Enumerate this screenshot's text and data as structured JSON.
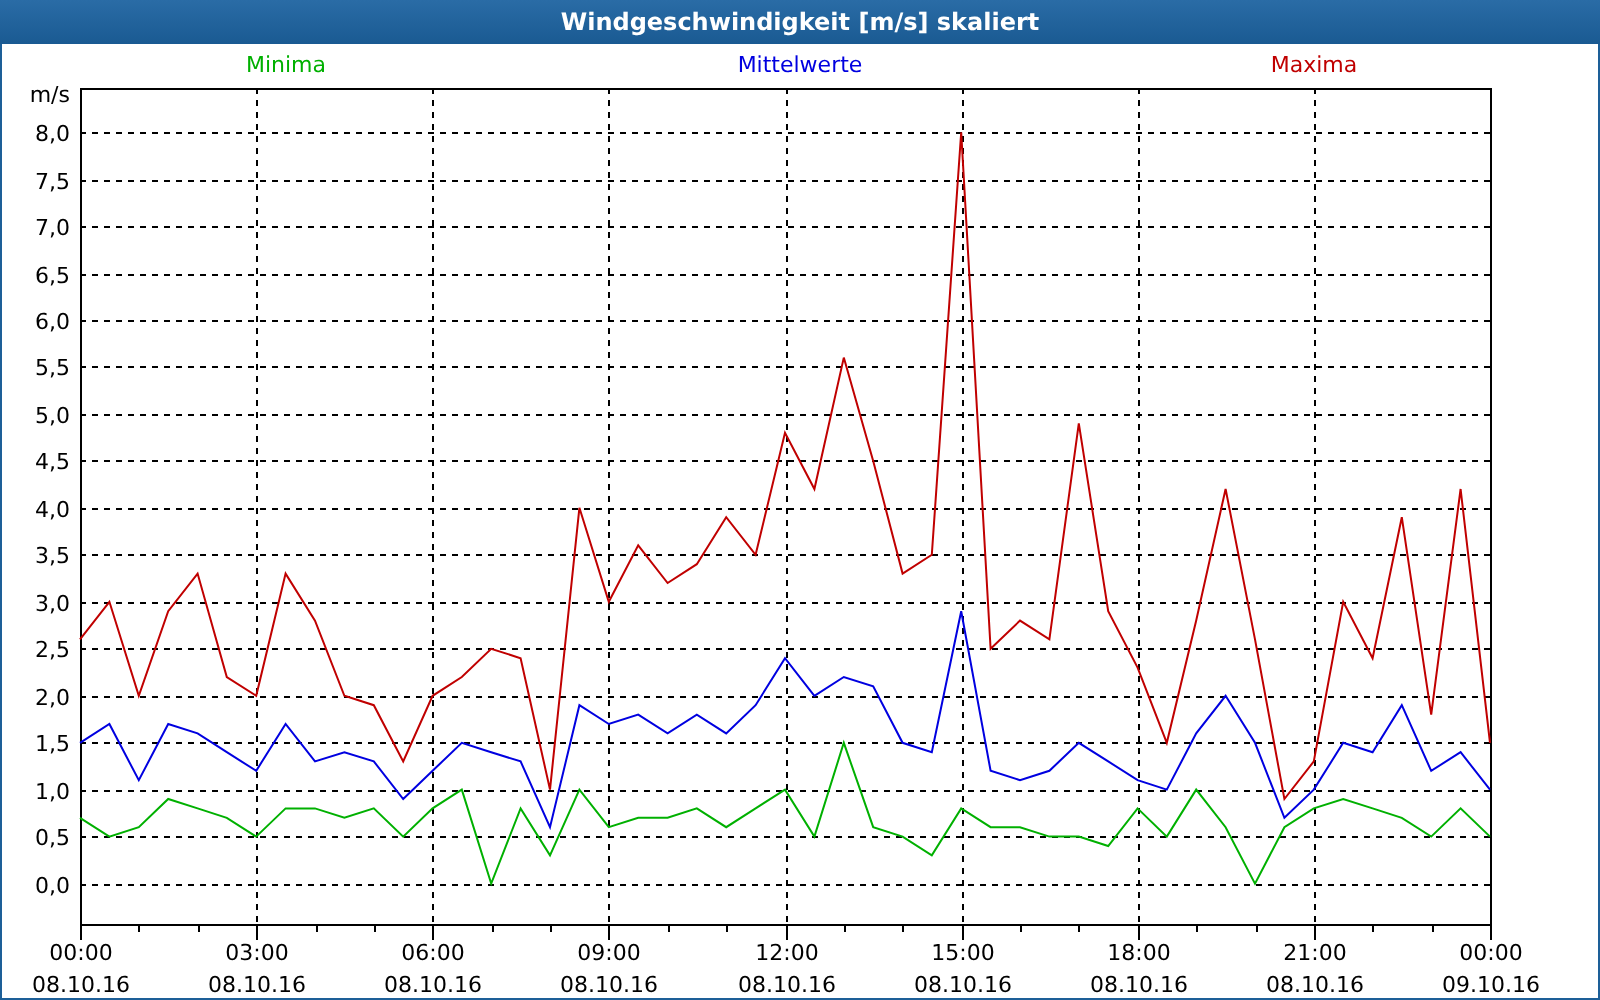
{
  "window": {
    "title": "Windgeschwindigkeit [m/s] skaliert"
  },
  "chart": {
    "chart_data": {
      "type": "line",
      "ylabel": "m/s",
      "x": [
        0,
        0.5,
        1,
        1.5,
        2,
        2.5,
        3,
        3.5,
        4,
        4.5,
        5,
        5.5,
        6,
        6.5,
        7,
        7.5,
        8,
        8.5,
        9,
        9.5,
        10,
        10.5,
        11,
        11.5,
        12,
        12.5,
        13,
        13.5,
        14,
        14.5,
        15,
        15.5,
        16,
        16.5,
        17,
        17.5,
        18,
        18.5,
        19,
        19.5,
        20,
        20.5,
        21,
        21.5,
        22,
        22.5,
        23,
        23.5,
        24
      ],
      "series": [
        {
          "name": "Minima",
          "color": "#00b000",
          "values": [
            0.7,
            0.5,
            0.6,
            0.9,
            0.8,
            0.7,
            0.5,
            0.8,
            0.8,
            0.7,
            0.8,
            0.5,
            0.8,
            1.0,
            0.0,
            0.8,
            0.3,
            1.0,
            0.6,
            0.7,
            0.7,
            0.8,
            0.6,
            0.8,
            1.0,
            0.5,
            1.5,
            0.6,
            0.5,
            0.3,
            0.8,
            0.6,
            0.6,
            0.5,
            0.5,
            0.4,
            0.8,
            0.5,
            1.0,
            0.6,
            0.0,
            0.6,
            0.8,
            0.9,
            0.8,
            0.7,
            0.5,
            0.8,
            0.5
          ]
        },
        {
          "name": "Mittelwerte",
          "color": "#0000e0",
          "values": [
            1.5,
            1.7,
            1.1,
            1.7,
            1.6,
            1.4,
            1.2,
            1.7,
            1.3,
            1.4,
            1.3,
            0.9,
            1.2,
            1.5,
            1.4,
            1.3,
            0.6,
            1.9,
            1.7,
            1.8,
            1.6,
            1.8,
            1.6,
            1.9,
            2.4,
            2.0,
            2.2,
            2.1,
            1.5,
            1.4,
            2.9,
            1.2,
            1.1,
            1.2,
            1.5,
            1.3,
            1.1,
            1.0,
            1.6,
            2.0,
            1.5,
            0.7,
            1.0,
            1.5,
            1.4,
            1.9,
            1.2,
            1.4,
            1.0
          ]
        },
        {
          "name": "Maxima",
          "color": "#c00000",
          "values": [
            2.6,
            3.0,
            2.0,
            2.9,
            3.3,
            2.2,
            2.0,
            3.3,
            2.8,
            2.0,
            1.9,
            1.3,
            2.0,
            2.2,
            2.5,
            2.4,
            1.0,
            4.0,
            3.0,
            3.6,
            3.2,
            3.4,
            3.9,
            3.5,
            4.8,
            4.2,
            5.6,
            4.5,
            3.3,
            3.5,
            8.0,
            2.5,
            2.8,
            2.6,
            4.9,
            2.9,
            2.3,
            1.5,
            2.8,
            4.2,
            2.6,
            0.9,
            1.3,
            3.0,
            2.4,
            3.9,
            1.8,
            4.2,
            1.5
          ]
        }
      ],
      "grid": true,
      "xlim": [
        0,
        24
      ],
      "ylim": [
        -0.43,
        8.47
      ],
      "xticks": [
        {
          "value": 0,
          "label": "00:00"
        },
        {
          "value": 3,
          "label": "03:00"
        },
        {
          "value": 6,
          "label": "06:00"
        },
        {
          "value": 9,
          "label": "09:00"
        },
        {
          "value": 12,
          "label": "12:00"
        },
        {
          "value": 15,
          "label": "15:00"
        },
        {
          "value": 18,
          "label": "18:00"
        },
        {
          "value": 21,
          "label": "21:00"
        },
        {
          "value": 24,
          "label": "00:00"
        }
      ],
      "yticks": [
        {
          "value": 0,
          "label": "0,0"
        },
        {
          "value": 0.5,
          "label": "0,5"
        },
        {
          "value": 1,
          "label": "1,0"
        },
        {
          "value": 1.5,
          "label": "1,5"
        },
        {
          "value": 2,
          "label": "2,0"
        },
        {
          "value": 2.5,
          "label": "2,5"
        },
        {
          "value": 3,
          "label": "3,0"
        },
        {
          "value": 3.5,
          "label": "3,5"
        },
        {
          "value": 4,
          "label": "4,0"
        },
        {
          "value": 4.5,
          "label": "4,5"
        },
        {
          "value": 5,
          "label": "5,0"
        },
        {
          "value": 5.5,
          "label": "5,5"
        },
        {
          "value": 6,
          "label": "6,0"
        },
        {
          "value": 6.5,
          "label": "6,5"
        },
        {
          "value": 7,
          "label": "7,0"
        },
        {
          "value": 7.5,
          "label": "7,5"
        },
        {
          "value": 8,
          "label": "8,0"
        }
      ]
    },
    "tick_dates": [
      "08.10.16",
      "08.10.16",
      "08.10.16",
      "08.10.16",
      "08.10.16",
      "08.10.16",
      "08.10.16",
      "08.10.16",
      "09.10.16"
    ]
  }
}
